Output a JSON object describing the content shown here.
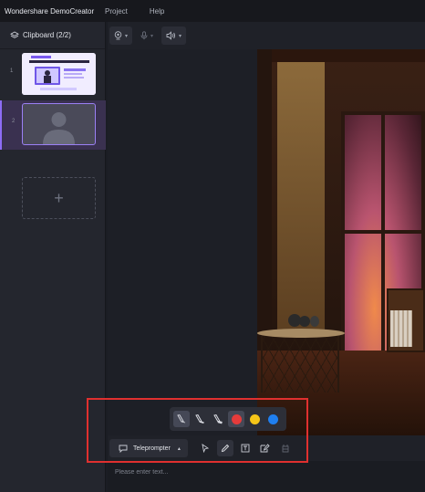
{
  "app": {
    "title": "Wondershare DemoCreator",
    "menus": [
      "Project",
      "Help"
    ]
  },
  "sidebar": {
    "header": "Clipboard (2/2)",
    "slides": [
      {
        "number": "1",
        "selected": false,
        "content": "presentation-thumbnail"
      },
      {
        "number": "2",
        "selected": true,
        "content": "avatar-placeholder"
      }
    ],
    "add_slot_symbol": "+"
  },
  "toolbar": {
    "items": [
      {
        "name": "webcam-icon"
      },
      {
        "name": "microphone-icon",
        "disabled": true
      },
      {
        "name": "speaker-icon"
      }
    ],
    "caret": "▾"
  },
  "drawing_tools": {
    "pens": [
      {
        "name": "pen-thin-icon",
        "selected": true
      },
      {
        "name": "pen-medium-icon",
        "selected": false
      },
      {
        "name": "pen-thick-icon",
        "selected": false
      }
    ],
    "colors": [
      {
        "hex": "#e53b3b",
        "selected": true
      },
      {
        "hex": "#f5c518",
        "selected": false
      },
      {
        "hex": "#1f7ff0",
        "selected": false
      }
    ]
  },
  "bottombar": {
    "teleprompter_label": "Teleprompter",
    "caret": "▴",
    "tools": [
      "cursor-icon",
      "pen-icon",
      "text-box-icon",
      "annotation-icon",
      "eraser-icon"
    ],
    "selected_tool": "pen-icon"
  },
  "text_area": {
    "placeholder": "Please enter text..."
  },
  "colors": {
    "accent": "#8d6cf5",
    "highlight": "#e0302f"
  }
}
